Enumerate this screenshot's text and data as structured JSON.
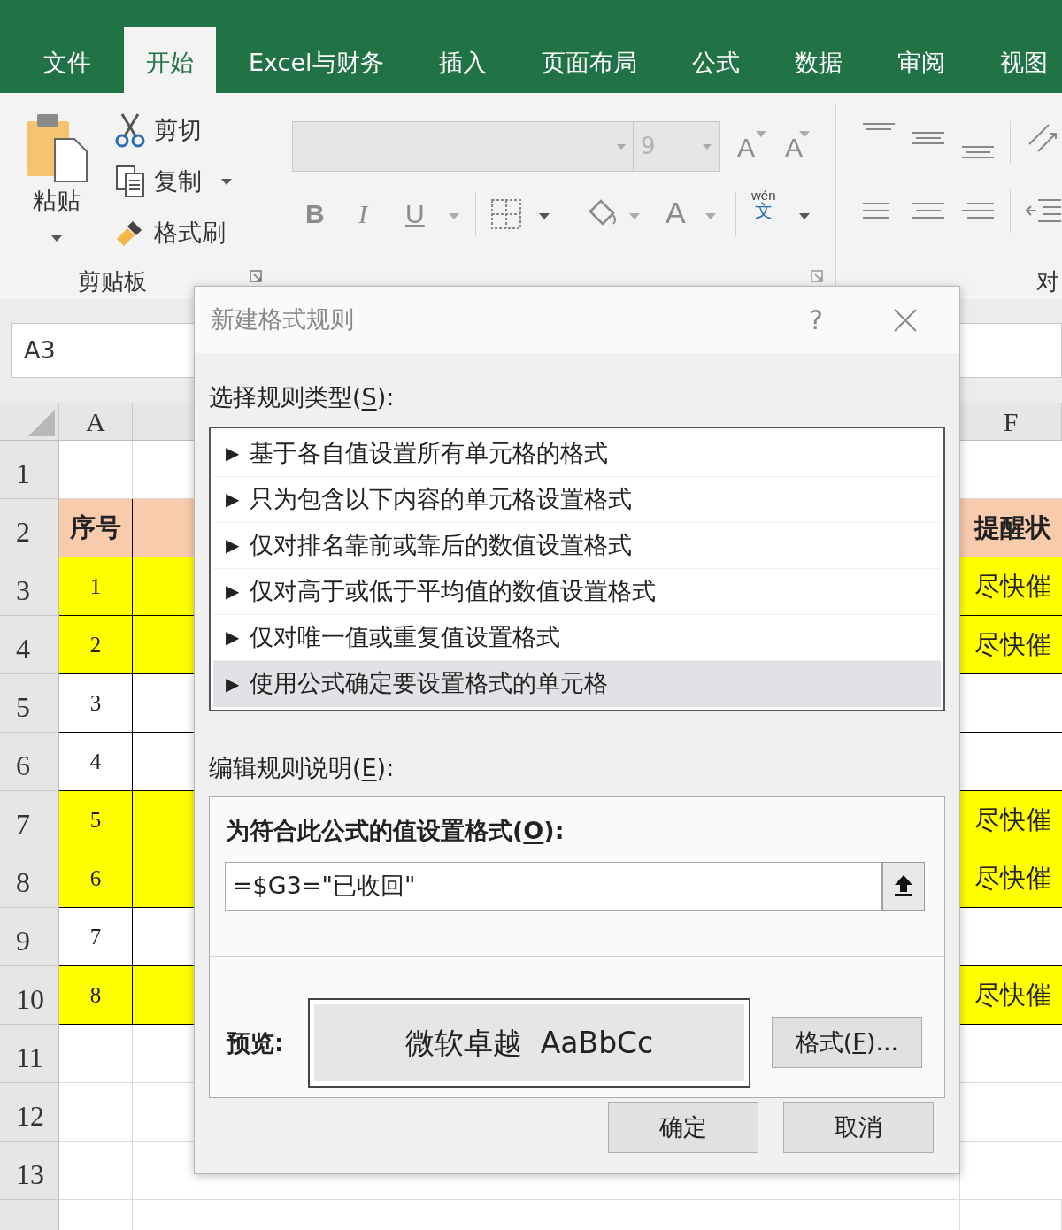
{
  "ribbon_tabs": [
    {
      "label": "文件",
      "selected": false
    },
    {
      "label": "开始",
      "selected": true
    },
    {
      "label": "Excel与财务",
      "selected": false
    },
    {
      "label": "插入",
      "selected": false
    },
    {
      "label": "页面布局",
      "selected": false
    },
    {
      "label": "公式",
      "selected": false
    },
    {
      "label": "数据",
      "selected": false
    },
    {
      "label": "审阅",
      "selected": false
    },
    {
      "label": "视图",
      "selected": false
    }
  ],
  "clipboard_group": {
    "paste": "粘贴",
    "cut": "剪切",
    "copy": "复制",
    "format_painter": "格式刷",
    "label": "剪贴板"
  },
  "font_group": {
    "font_size": "9",
    "grow_font": "A",
    "shrink_font": "A",
    "bold": "B",
    "italic": "I",
    "underline": "U",
    "font_color": "A",
    "phonetic_top": "wén",
    "phonetic_bottom": "文"
  },
  "alignment_group": {
    "label": "对"
  },
  "name_box": "A3",
  "column_headers": [
    "A",
    "F"
  ],
  "rows": [
    {
      "number": "1",
      "kind": "blank"
    },
    {
      "number": "2",
      "kind": "header",
      "cell_a": "序号",
      "cell_f": "提醒状"
    },
    {
      "number": "3",
      "kind": "data",
      "cell_a": "1",
      "highlighted": true,
      "cell_f": "尽快催"
    },
    {
      "number": "4",
      "kind": "data",
      "cell_a": "2",
      "highlighted": true,
      "cell_f": "尽快催"
    },
    {
      "number": "5",
      "kind": "data",
      "cell_a": "3",
      "highlighted": false
    },
    {
      "number": "6",
      "kind": "data",
      "cell_a": "4",
      "highlighted": false
    },
    {
      "number": "7",
      "kind": "data",
      "cell_a": "5",
      "highlighted": true,
      "cell_f": "尽快催"
    },
    {
      "number": "8",
      "kind": "data",
      "cell_a": "6",
      "highlighted": true,
      "cell_f": "尽快催"
    },
    {
      "number": "9",
      "kind": "data",
      "cell_a": "7",
      "highlighted": false
    },
    {
      "number": "10",
      "kind": "data",
      "cell_a": "8",
      "highlighted": true,
      "cell_f": "尽快催"
    },
    {
      "number": "11",
      "kind": "blank"
    },
    {
      "number": "12",
      "kind": "blank"
    },
    {
      "number": "13",
      "kind": "blank"
    }
  ],
  "dialog": {
    "title": "新建格式规则",
    "help": "?",
    "rule_type_label": {
      "before": "选择规则类型(",
      "key": "S",
      "after": "):"
    },
    "rule_types": [
      {
        "arrow": "▶",
        "label": "基于各自值设置所有单元格的格式",
        "selected": false
      },
      {
        "arrow": "▶",
        "label": "只为包含以下内容的单元格设置格式",
        "selected": false
      },
      {
        "arrow": "▶",
        "label": "仅对排名靠前或靠后的数值设置格式",
        "selected": false
      },
      {
        "arrow": "▶",
        "label": "仅对高于或低于平均值的数值设置格式",
        "selected": false
      },
      {
        "arrow": "▶",
        "label": "仅对唯一值或重复值设置格式",
        "selected": false
      },
      {
        "arrow": "▶",
        "label": "使用公式确定要设置格式的单元格",
        "selected": true
      }
    ],
    "description_label": {
      "before": "编辑规则说明(",
      "key": "E",
      "after": "):"
    },
    "formula_label": {
      "before": "为符合此公式的值设置格式(",
      "key": "O",
      "after": "):"
    },
    "formula": "=$G3=\"已收回\"",
    "preview_label": "预览:",
    "preview_text": "微软卓越  AaBbCc",
    "format_button": {
      "before": "格式(",
      "key": "F",
      "after": ")..."
    },
    "ok": "确定",
    "cancel": "取消"
  }
}
